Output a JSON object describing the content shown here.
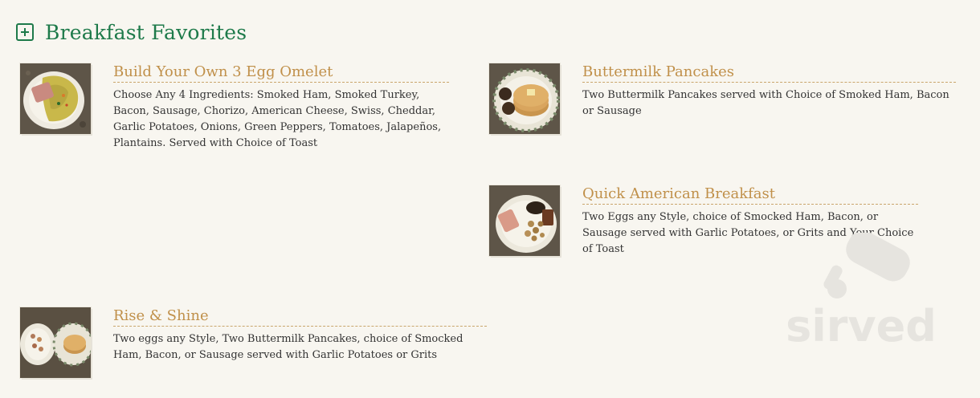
{
  "section": {
    "title": "Breakfast Favorites"
  },
  "items": [
    {
      "title": "Build Your Own 3 Egg Omelet",
      "description": "Choose Any 4 Ingredients: Smoked Ham, Smoked Turkey, Bacon, Sausage, Chorizo, American Cheese, Swiss, Cheddar, Garlic Potatoes, Onions, Green Peppers, Tomatoes, Jalapeños, Plantains. Served with Choice of Toast"
    },
    {
      "title": "Buttermilk Pancakes",
      "description": "Two Buttermilk Pancakes served with Choice of Smoked Ham, Bacon or Sausage"
    },
    {
      "title": "Quick American Breakfast",
      "description": "Two Eggs any Style, choice of Smocked Ham, Bacon, or Sausage served with Garlic Potatoes, or Grits and Your Choice of Toast"
    },
    {
      "title": "Rise & Shine",
      "description": "Two eggs any Style, Two Buttermilk Pancakes, choice of Smocked Ham, Bacon, or Sausage served with Garlic Potatoes or Grits"
    }
  ],
  "watermark": {
    "text": "sirved"
  }
}
